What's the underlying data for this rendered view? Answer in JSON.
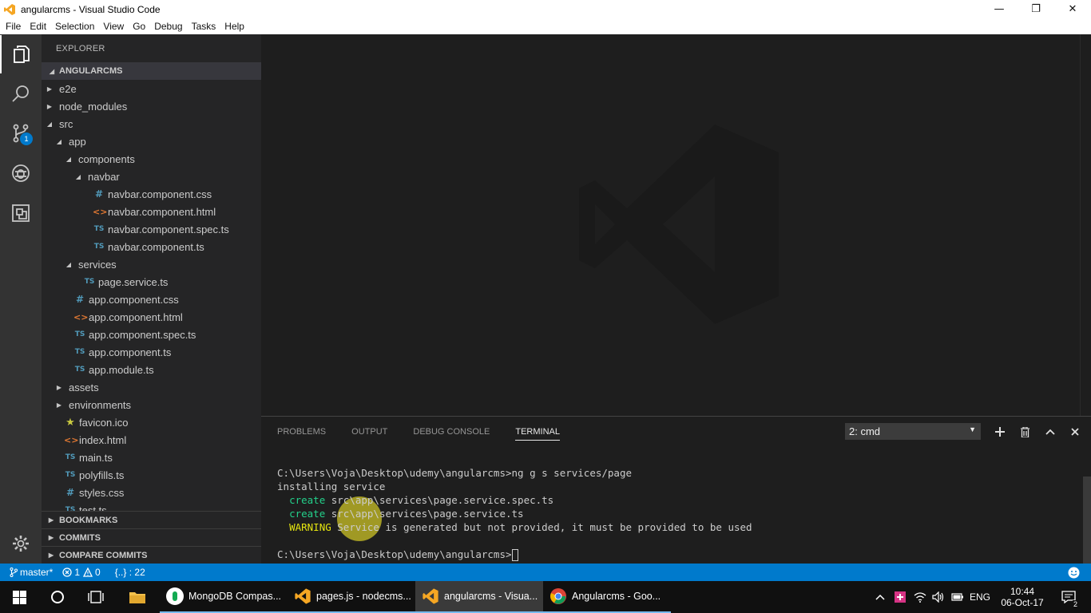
{
  "window": {
    "title": "angularcms - Visual Studio Code",
    "minimize": "—",
    "restore": "❐",
    "close": "✕"
  },
  "menu": [
    "File",
    "Edit",
    "Selection",
    "View",
    "Go",
    "Debug",
    "Tasks",
    "Help"
  ],
  "activity_bar": {
    "scm_badge": "1"
  },
  "explorer": {
    "title": "EXPLORER",
    "project": "ANGULARCMS",
    "tree": [
      {
        "label": "e2e",
        "type": "folder",
        "expanded": false,
        "depth": 1
      },
      {
        "label": "node_modules",
        "type": "folder",
        "expanded": false,
        "depth": 1
      },
      {
        "label": "src",
        "type": "folder",
        "expanded": true,
        "depth": 1
      },
      {
        "label": "app",
        "type": "folder",
        "expanded": true,
        "depth": 2
      },
      {
        "label": "components",
        "type": "folder",
        "expanded": true,
        "depth": 3
      },
      {
        "label": "navbar",
        "type": "folder",
        "expanded": true,
        "depth": 4
      },
      {
        "label": "navbar.component.css",
        "type": "css",
        "depth": 5
      },
      {
        "label": "navbar.component.html",
        "type": "html",
        "depth": 5
      },
      {
        "label": "navbar.component.spec.ts",
        "type": "ts",
        "depth": 5
      },
      {
        "label": "navbar.component.ts",
        "type": "ts",
        "depth": 5
      },
      {
        "label": "services",
        "type": "folder",
        "expanded": true,
        "depth": 3
      },
      {
        "label": "page.service.ts",
        "type": "ts",
        "depth": 4
      },
      {
        "label": "app.component.css",
        "type": "css",
        "depth": 3
      },
      {
        "label": "app.component.html",
        "type": "html",
        "depth": 3
      },
      {
        "label": "app.component.spec.ts",
        "type": "ts",
        "depth": 3
      },
      {
        "label": "app.component.ts",
        "type": "ts",
        "depth": 3
      },
      {
        "label": "app.module.ts",
        "type": "ts",
        "depth": 3
      },
      {
        "label": "assets",
        "type": "folder",
        "expanded": false,
        "depth": 2
      },
      {
        "label": "environments",
        "type": "folder",
        "expanded": false,
        "depth": 2
      },
      {
        "label": "favicon.ico",
        "type": "ico",
        "depth": 2
      },
      {
        "label": "index.html",
        "type": "html",
        "depth": 2
      },
      {
        "label": "main.ts",
        "type": "ts",
        "depth": 2
      },
      {
        "label": "polyfills.ts",
        "type": "ts",
        "depth": 2
      },
      {
        "label": "styles.css",
        "type": "css",
        "depth": 2
      },
      {
        "label": "test.ts",
        "type": "ts",
        "depth": 2
      }
    ],
    "sections": [
      "BOOKMARKS",
      "COMMITS",
      "COMPARE COMMITS"
    ]
  },
  "panel": {
    "tabs": [
      "PROBLEMS",
      "OUTPUT",
      "DEBUG CONSOLE",
      "TERMINAL"
    ],
    "active_tab": "TERMINAL",
    "terminal_select": "2: cmd",
    "terminal": {
      "line1": "C:\\Users\\Voja\\Desktop\\udemy\\angularcms>ng g s services/page",
      "line2": "installing service",
      "line3_kw": "create",
      "line3_rest": " src\\app\\services\\page.service.spec.ts",
      "line4_kw": "create",
      "line4_rest": " src\\app\\services\\page.service.ts",
      "line5_kw": "WARNING",
      "line5_rest": " Service is generated but not provided, it must be provided to be used",
      "prompt": "C:\\Users\\Voja\\Desktop\\udemy\\angularcms>"
    }
  },
  "statusbar": {
    "branch": "master*",
    "errors": "1",
    "warnings": "0",
    "braces": "{..} : 22"
  },
  "taskbar": {
    "apps": [
      {
        "label": "MongoDB Compas...",
        "color": "#ffffff"
      },
      {
        "label": "pages.js - nodecms...",
        "color": "#f5a623"
      },
      {
        "label": "angularcms - Visua...",
        "color": "#f5a623"
      },
      {
        "label": "Angularcms - Goo...",
        "color": "#4285f4"
      }
    ],
    "lang": "ENG",
    "time": "10:44",
    "date": "06-Oct-17",
    "notif_count": "2"
  }
}
